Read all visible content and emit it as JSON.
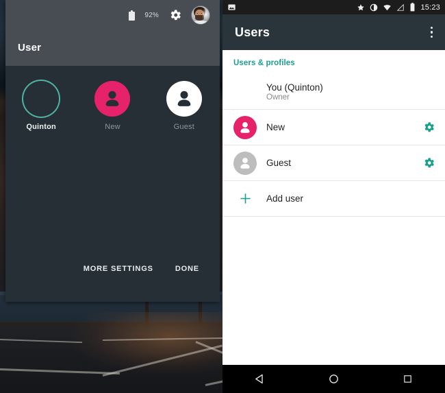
{
  "quick_settings": {
    "title": "User",
    "status": {
      "battery_icon": "battery-icon",
      "battery_percent": "92%",
      "settings_icon": "gear-icon",
      "avatar_icon": "avatar-quinton"
    },
    "users": [
      {
        "name": "Quinton",
        "type": "photo",
        "selected": true,
        "icon": "avatar-photo"
      },
      {
        "name": "New",
        "type": "pink",
        "selected": false,
        "icon": "person-icon"
      },
      {
        "name": "Guest",
        "type": "white",
        "selected": false,
        "icon": "person-icon"
      }
    ],
    "buttons": {
      "more_settings": "MORE SETTINGS",
      "done": "DONE"
    }
  },
  "phone": {
    "status_bar": {
      "left_icons": [
        "screenshot-icon"
      ],
      "right_icons": [
        "star-icon",
        "do-not-disturb-icon",
        "wifi-icon",
        "signal-icon",
        "battery-icon"
      ],
      "time": "15:23"
    },
    "app_bar": {
      "title": "Users",
      "overflow_icon": "kebab-menu-icon"
    },
    "section_label": "Users & profiles",
    "rows": [
      {
        "title": "You (Quinton)",
        "subtitle": "Owner",
        "avatar": "photo",
        "gear": false,
        "gear_icon": ""
      },
      {
        "title": "New",
        "subtitle": "",
        "avatar": "pink",
        "gear": true,
        "gear_icon": "gear-icon"
      },
      {
        "title": "Guest",
        "subtitle": "",
        "avatar": "grey",
        "gear": true,
        "gear_icon": "gear-icon"
      },
      {
        "title": "Add user",
        "subtitle": "",
        "avatar": "plus",
        "gear": false,
        "gear_icon": ""
      }
    ],
    "nav_bar": {
      "back": "back-icon",
      "home": "home-icon",
      "recents": "recents-icon"
    }
  },
  "colors": {
    "accent_teal": "#1a9e8e",
    "user_pink": "#e6226a",
    "guest_grey": "#bdbdbd",
    "panel_dark": "#262f35",
    "panel_header": "#474d53",
    "appbar": "#2a343b",
    "selected_ring": "#4fb3a4"
  }
}
